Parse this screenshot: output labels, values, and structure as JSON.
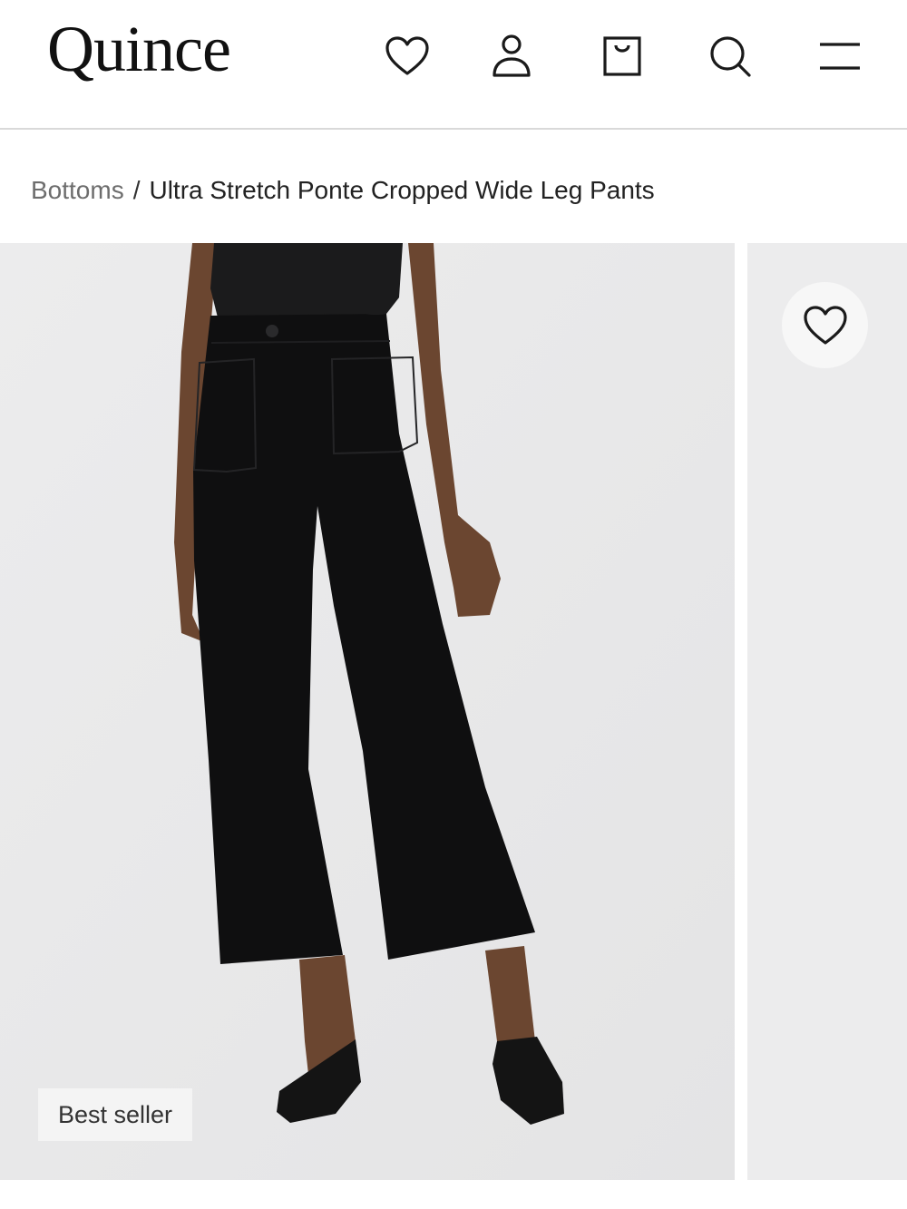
{
  "header": {
    "logo": "Quince",
    "icons": [
      "heart-icon",
      "user-icon",
      "shopping-bag-icon",
      "search-icon",
      "menu-icon"
    ]
  },
  "breadcrumb": {
    "parent": "Bottoms",
    "separator": "/",
    "current": "Ultra Stretch Ponte Cropped Wide Leg Pants"
  },
  "gallery": {
    "badge": "Best seller",
    "favorite_icon": "heart-icon"
  },
  "colors": {
    "image_background": "#e9e9ea",
    "product": "#0f0f10",
    "skin": "#6b4630"
  }
}
